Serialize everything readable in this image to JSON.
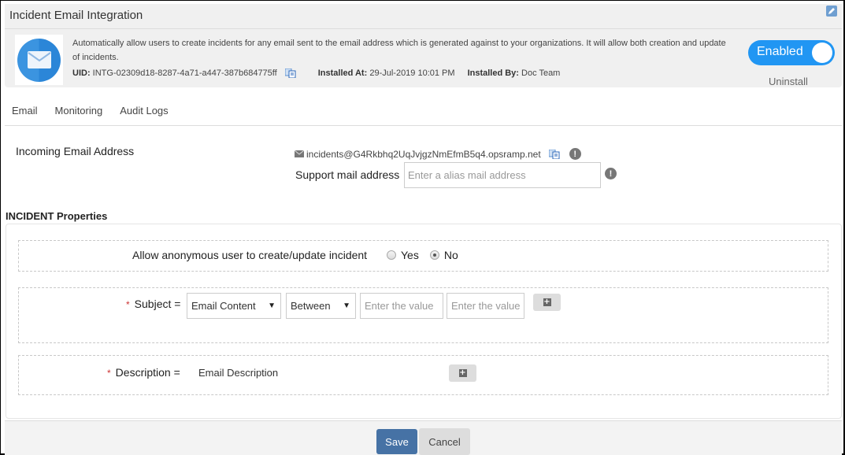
{
  "header": {
    "title": "Incident Email Integration",
    "description": "Automatically allow users to create incidents for any email sent to the email address which is generated against to your organizations. It will allow both creation and update of incidents.",
    "uid_label": "UID:",
    "uid_value": "INTG-02309d18-8287-4a71-a447-387b684775ff",
    "installed_at_label": "Installed At:",
    "installed_at_value": "29-Jul-2019 10:01 PM",
    "installed_by_label": "Installed By:",
    "installed_by_value": "Doc Team",
    "toggle_label": "Enabled",
    "uninstall_label": "Uninstall",
    "accent_color": "#2196f3"
  },
  "tabs": [
    {
      "label": "Email"
    },
    {
      "label": "Monitoring"
    },
    {
      "label": "Audit Logs"
    }
  ],
  "email": {
    "incoming_label": "Incoming Email Address",
    "incoming_address": "incidents@G4Rkbhq2UqJvjgzNmEfmB5q4.opsramp.net",
    "support_label": "Support mail address",
    "support_placeholder": "Enter a alias mail address",
    "support_value": ""
  },
  "incident_properties": {
    "title": "INCIDENT Properties",
    "anonymous": {
      "label": "Allow anonymous user to create/update incident",
      "options": [
        {
          "label": "Yes",
          "selected": false
        },
        {
          "label": "No",
          "selected": true
        }
      ]
    },
    "subject": {
      "required_mark": "*",
      "label": "Subject =",
      "field_select": "Email Content",
      "operator_select": "Between",
      "value1_placeholder": "Enter the value",
      "value2_placeholder": "Enter the value"
    },
    "description": {
      "required_mark": "*",
      "label": "Description =",
      "value": "Email Description"
    }
  },
  "footer": {
    "save_label": "Save",
    "cancel_label": "Cancel"
  }
}
